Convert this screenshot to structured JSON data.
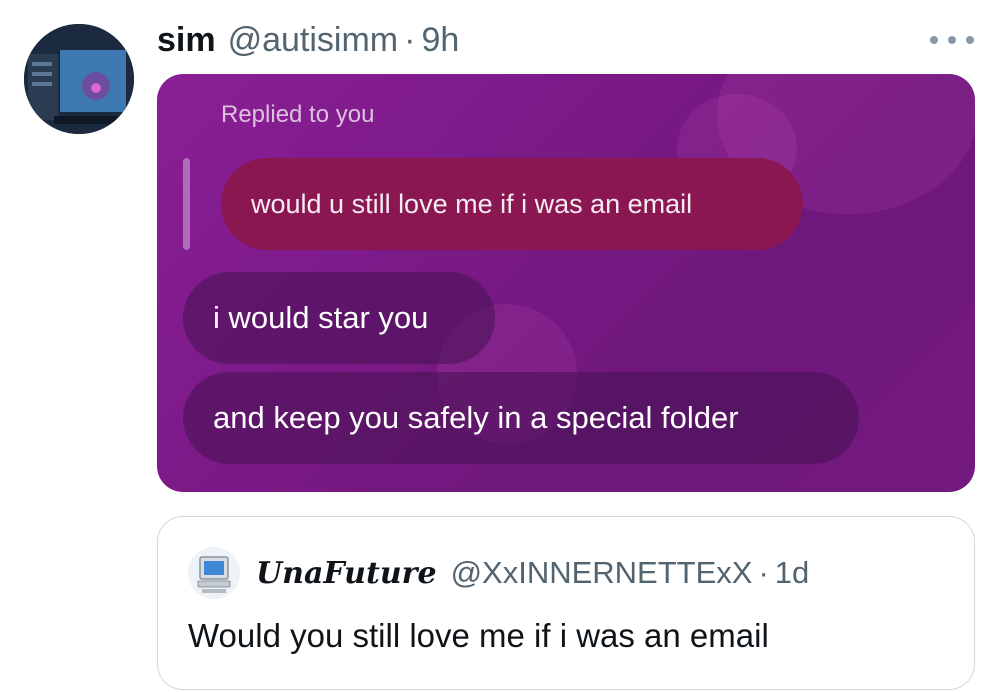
{
  "tweet": {
    "author_name": "sim",
    "author_handle": "@autisimm",
    "separator": "·",
    "time": "9h",
    "more_icon": "more-horizontal-icon"
  },
  "media": {
    "replied_label": "Replied to you",
    "quoted_message": "would u still love me if i was an email",
    "reply_messages": [
      "i would star you",
      "and keep you safely in a special folder"
    ],
    "colors": {
      "background": "#7c1a88",
      "quoted_bubble": "#8b1752"
    }
  },
  "quoted_tweet": {
    "author_name": "UnaFuture",
    "author_handle": "@XxINNERNETTExX",
    "separator": "·",
    "time": "1d",
    "text": "Would you still love me if i was an email"
  }
}
